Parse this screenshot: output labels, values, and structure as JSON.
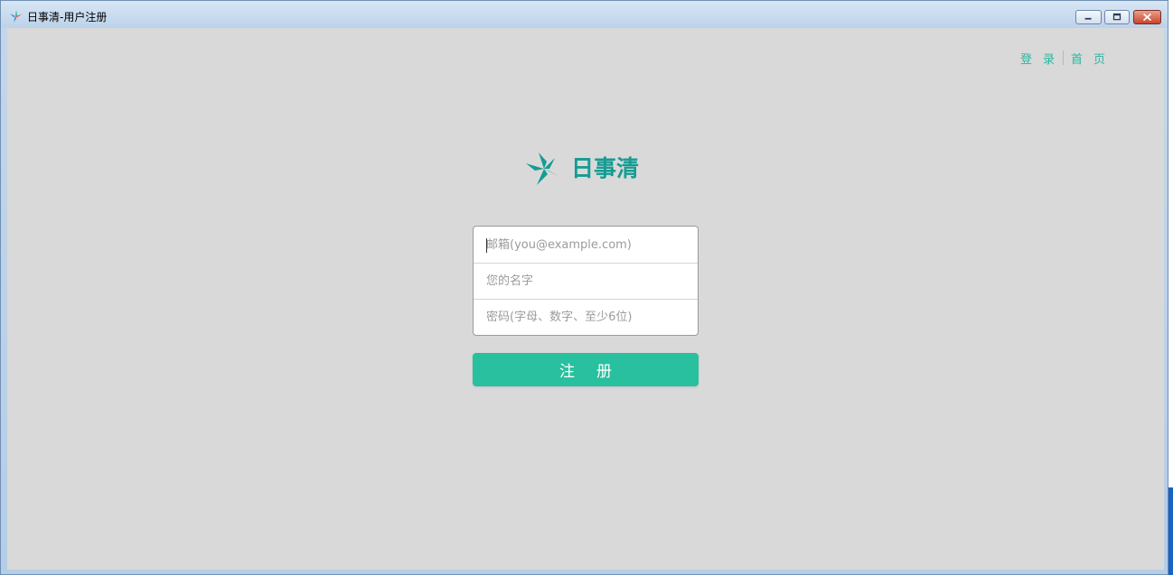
{
  "window": {
    "title": "日事清-用户注册",
    "controls": {
      "minimize": "minimize-icon",
      "maximize": "maximize-icon",
      "close": "close-icon"
    }
  },
  "nav": {
    "login": "登录",
    "home": "首页"
  },
  "brand": {
    "name": "日事清",
    "logo_icon": "pinwheel-logo-icon",
    "color": "#149c93"
  },
  "form": {
    "email": {
      "placeholder": "邮箱(you@example.com)",
      "value": ""
    },
    "name": {
      "placeholder": "您的名字",
      "value": ""
    },
    "password": {
      "placeholder": "密码(字母、数字、至少6位)",
      "value": ""
    },
    "submit_label": "注册"
  },
  "colors": {
    "accent": "#28c09e",
    "nav_link": "#27b8a0",
    "background": "#d9d9d9"
  }
}
